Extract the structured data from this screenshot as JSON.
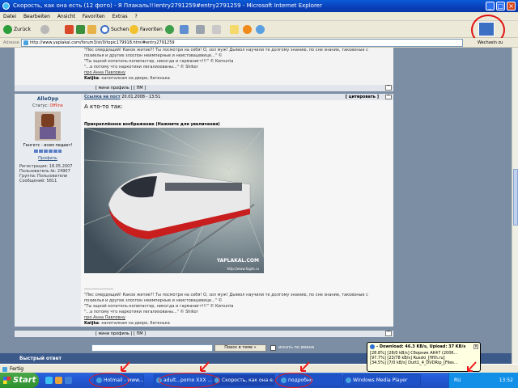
{
  "window": {
    "title": "Скорость, как она есть (12 фото) - Я Плакаль!!!entry2791259#entry2791259 - Microsoft Internet Explorer",
    "min": "_",
    "max": "□",
    "close": "×"
  },
  "menu": [
    "Datei",
    "Bearbeiten",
    "Ansicht",
    "Favoriten",
    "Extras",
    "?"
  ],
  "toolbar": {
    "back_label": "Zurück",
    "search_label": "Suchen",
    "favorites_label": "Favoriten"
  },
  "address": {
    "label": "Adresse",
    "url": "http://www.yaplakal.com/forum3/st/0/topic179918.html#entry2791259",
    "links_label": "Wechseln zu",
    "links_more": "Links"
  },
  "quoted_top": {
    "line1": "\"Пес смердящий! Какое житие?! Ты посмотри на себя! О, зол муж! Дьявол научили те долгому знанию, по сне знание, таковоные с",
    "line2": "позиелья и другие злоспон неимперные и неистовацевице...\" ©",
    "line3": "\"Ты эщкой копатель-копипастер, никогда и гарманигт!!!\" © Komunta",
    "line4": "\"...а потому что наркотики легализованы...\" © Shikor",
    "line5": "про Анна Павловну",
    "line6_bold": "Katjka",
    "line6": ": капиталкам на дворе, батенька"
  },
  "profile_bar": {
    "left": "[ мини профиль ] [ ПМ ]",
    "up": "^"
  },
  "author": {
    "nick": "AlleOpp",
    "status_label": "Статус: ",
    "status": "Offline",
    "motto": "Генгетс - всем педает!",
    "profile_link": "Профиль",
    "meta": [
      "Регистрация: 18.05.2007",
      "Пользователь №: 24907",
      "Группа: Пользователи",
      "Сообщений: 5811"
    ]
  },
  "post": {
    "link": "Ссылка на пост",
    "date": "20.01.2008 - 13:51",
    "cite_label": "[ цитировать ]",
    "up": "^",
    "text": "А кто-то так:",
    "attached": "Прикреплённое изображение (Нажмите для увеличения)",
    "watermark": "YAPLAKAL.COM",
    "watermark2": "http://www.fagds.ru"
  },
  "dashes": "--------------------",
  "quoted_bottom": {
    "line1": "\"Пес смердящий! Какое житие?! Ты посмотри на себя! О, зол муж! Дьявол научили те долгому знанию, по сне знание, таковоные с",
    "line2": "позиелья и другие злоспон неимперные и неистовацевице...\" ©",
    "line3": "\"Ты эщкой копатель-копипастер, никогда и гарманигт!!!\" © Komunta",
    "line4": "\"...а потому что наркотики легализованы...\" © Shikor",
    "line5": "про Анна Павловну",
    "line6_bold": "Katjka",
    "line6": ": капиталкам на дворе, батенька"
  },
  "profile_bar2": {
    "left": "[ мини профиль ] [ ПМ ]",
    "up": "^"
  },
  "search": {
    "button": "Поиск в теме »",
    "checkbox_label": "искать по имени"
  },
  "quick_reply": "Быстрый ответ",
  "status": "Fertig",
  "taskbar": {
    "start": "Start",
    "tasks": [
      "Hotmail - www...",
      "adult...porno XXX ...",
      "Скорость, как она е...",
      "подробно"
    ],
    "media_player": "Windows Media Player",
    "lang": "RU",
    "clock": "13:52"
  },
  "tooltip": {
    "title": "- Download: 46.3 KB/s, Upload: 37 KB/s",
    "lines": [
      "[28.8%] [28/0 kB/s] Сборник AK47 (2006...",
      "[97.7%] [23/78 kB/s] Russki_[fifth.ru]",
      "[34.5%] [7/0 kB/s] Dutt1_4_DVDRip_[Files..."
    ],
    "close": "×"
  },
  "colors": {
    "accent": "#0a3fb8",
    "forum_bg": "#7b8ea3",
    "offline": "#dd2211",
    "annotation": "#f01818"
  }
}
